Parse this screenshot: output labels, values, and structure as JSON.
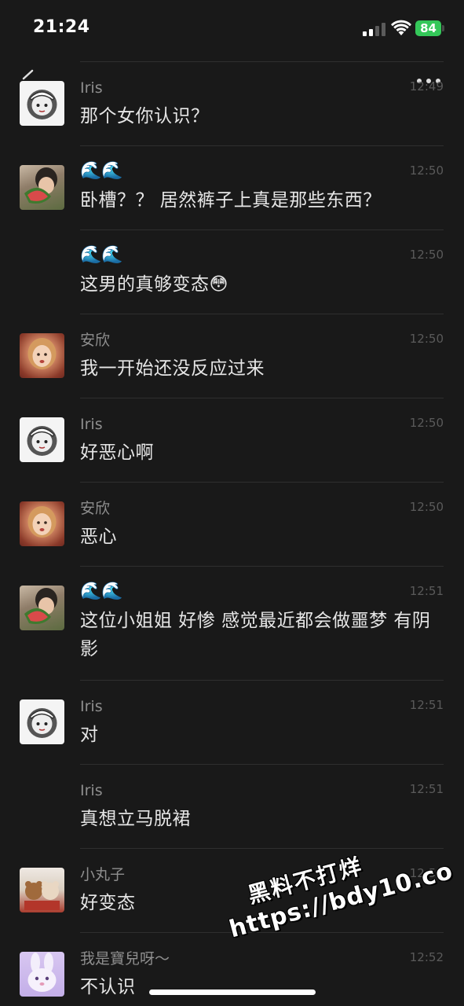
{
  "status_bar": {
    "time": "21:24",
    "battery": "84"
  },
  "messages": [
    {
      "sender": "Iris",
      "time": "12:49",
      "text": "那个女你认识？",
      "avatar": "iris"
    },
    {
      "sender": "🌊🌊",
      "time": "12:50",
      "text": "卧槽？？ 居然裤子上真是那些东西？",
      "avatar": "watermelon-girl"
    },
    {
      "sender": "🌊🌊",
      "time": "12:50",
      "text": "这男的真够变态😳",
      "avatar": ""
    },
    {
      "sender": "安欣",
      "time": "12:50",
      "text": "我一开始还没反应过来",
      "avatar": "anxin"
    },
    {
      "sender": "Iris",
      "time": "12:50",
      "text": "好恶心啊",
      "avatar": "iris"
    },
    {
      "sender": "安欣",
      "time": "12:50",
      "text": "恶心",
      "avatar": "anxin"
    },
    {
      "sender": "🌊🌊",
      "time": "12:51",
      "text": "这位小姐姐 好惨  感觉最近都会做噩梦 有阴影",
      "avatar": "watermelon-girl"
    },
    {
      "sender": "Iris",
      "time": "12:51",
      "text": "对",
      "avatar": "iris"
    },
    {
      "sender": "Iris",
      "time": "12:51",
      "text": "真想立马脱裙",
      "avatar": ""
    },
    {
      "sender": "小丸子",
      "time": "12:51",
      "text": "好变态",
      "avatar": "xiaowanzi"
    },
    {
      "sender": "我是寶兒呀～",
      "time": "12:52",
      "text": "不认识",
      "avatar": "baoer"
    }
  ],
  "watermark": {
    "line1": "黑料不打烊",
    "line2": "https://bdy10.co"
  }
}
